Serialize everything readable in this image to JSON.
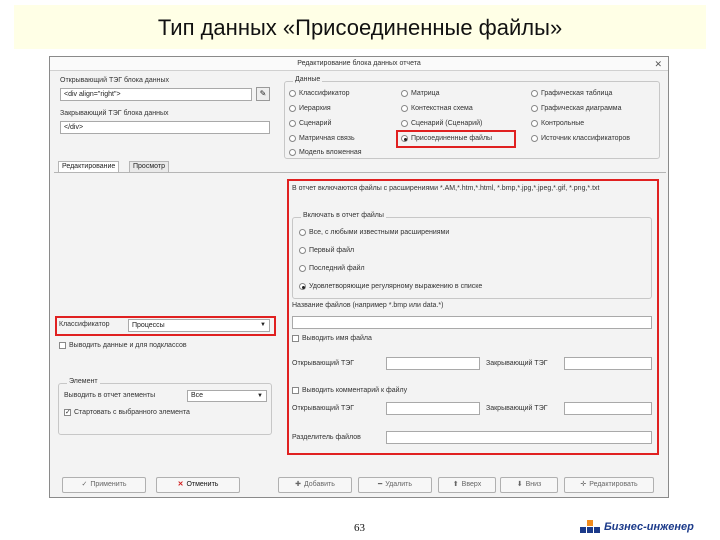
{
  "slide": {
    "title": "Тип данных «Присоединенные файлы»",
    "page_number": "63",
    "brand": "Бизнес-инженер"
  },
  "dialog": {
    "title": "Редактирование блока данных отчета",
    "close": "✕",
    "open_label": "Открывающий ТЭГ блока данных",
    "open_value": "<div align=\"right\">",
    "close_label": "Закрывающий ТЭГ блока данных",
    "close_value": "</div>",
    "macro_button": "✎",
    "data_group": {
      "title": "Данные",
      "options": [
        {
          "label": "Классификатор",
          "selected": false
        },
        {
          "label": "Матрица",
          "selected": false
        },
        {
          "label": "Графическая таблица",
          "selected": false
        },
        {
          "label": "Иерархия",
          "selected": false
        },
        {
          "label": "Контекстная схема",
          "selected": false
        },
        {
          "label": "Графическая диаграмма",
          "selected": false
        },
        {
          "label": "Сценарий",
          "selected": false
        },
        {
          "label": "Сценарий (Сценарий)",
          "selected": false
        },
        {
          "label": "Контрольные",
          "selected": false
        },
        {
          "label": "Матричная связь",
          "selected": false
        },
        {
          "label": "Присоединенные файлы",
          "selected": true
        },
        {
          "label": "Источник классификаторов",
          "selected": false
        },
        {
          "label": "Модель вложенная",
          "selected": false
        }
      ]
    },
    "tabs": [
      "Редактирование",
      "Просмотр"
    ],
    "extensions_text": "В отчет включаются файлы с расширениями *.AM,*.htm,*.html, *.bmp,*.jpg,*.jpeg,*.gif, *.png,*.txt",
    "include_group": {
      "title": "Включать в отчет файлы",
      "options": [
        {
          "label": "Все, с любыми известными расширениями",
          "selected": false
        },
        {
          "label": "Первый файл",
          "selected": false
        },
        {
          "label": "Последний файл",
          "selected": false
        },
        {
          "label": "Удовлетворяющие регулярному выражению в списке",
          "selected": true
        }
      ]
    },
    "file_name_label": "Название файлов (например *.bmp или data.*)",
    "file_name_value": "",
    "classifier_label": "Классификатор",
    "classifier_value": "Процессы",
    "include_subclasses_label": "Выводить данные и для подклассов",
    "element_group": {
      "title": "Элемент",
      "show_label": "Выводить в отчет элементы",
      "show_value": "Все",
      "start_label": "Стартовать с выбранного элемента"
    },
    "show_file_name_label": "Выводить имя файла",
    "open_tag_label": "Открывающий ТЭГ",
    "close_tag_label": "Закрывающий ТЭГ",
    "show_comment_label": "Выводить комментарий к файлу",
    "comment_open_label": "Открывающий ТЭГ",
    "comment_close_label": "Закрывающий ТЭГ",
    "separator_label": "Разделитель файлов",
    "buttons": {
      "apply": "Применить",
      "cancel": "Отменить",
      "add": "Добавить",
      "delete": "Удалить",
      "up": "Вверх",
      "down": "Вниз",
      "edit": "Редактировать"
    }
  }
}
